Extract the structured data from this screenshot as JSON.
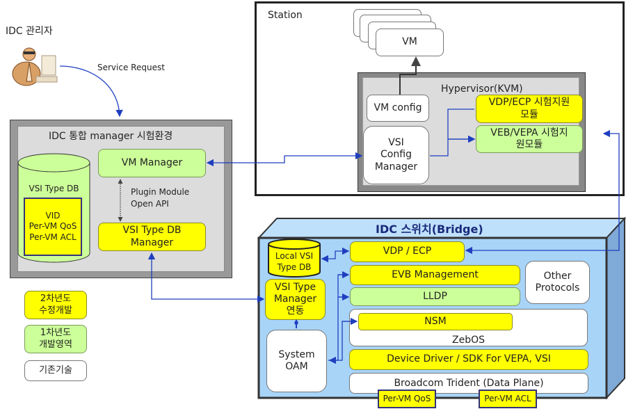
{
  "admin": {
    "label": "IDC 관리자",
    "icon": "person-at-computer-icon"
  },
  "service_request": "Service Request",
  "manager_env": {
    "title": "IDC 통합 manager 시험환경",
    "db": {
      "label": "VSI Type DB",
      "items": [
        "VID",
        "Per-VM  QoS",
        "Per-VM  ACL"
      ]
    },
    "vm_manager": "VM Manager",
    "plugin_label": [
      "Plugin  Module",
      "Open  API"
    ],
    "vsi_db_manager": [
      "VSI Type DB",
      "Manager"
    ]
  },
  "station": {
    "title": "Station",
    "vm": "VM",
    "hypervisor": "Hypervisor(KVM)",
    "vm_config": "VM config",
    "vsi_config_manager": [
      "VSI",
      "Config",
      "Manager"
    ],
    "vdp_ecp_module": [
      "VDP/ECP 시험지원",
      "모듈"
    ],
    "veb_vepa_module": [
      "VEB/VEPA  시험지",
      "원모듈"
    ]
  },
  "bridge": {
    "title": "IDC 스위치(Bridge)",
    "local_db": [
      "Local  VSI",
      "Type  DB"
    ],
    "vsi_type_manager": [
      "VSI Type",
      "Manager",
      "연동"
    ],
    "system_oam": [
      "System",
      "OAM"
    ],
    "vdp_ecp": "VDP / ECP",
    "evb_mgmt": "EVB Management",
    "lldp": "LLDP",
    "other_protocols": [
      "Other",
      "Protocols"
    ],
    "nsm": "NSM",
    "zebos": "ZebOS",
    "device_driver": "Device Driver  /  SDK For VEPA, VSI",
    "broadcom": "Broadcom Trident (Data Plane)",
    "per_vm_qos": "Per-VM  QoS",
    "per_vm_acl": "Per-VM  ACL"
  },
  "legend": [
    {
      "label": [
        "2차년도",
        "수정개발"
      ],
      "color": "#ffff00"
    },
    {
      "label": [
        "1차년도",
        "개발영역"
      ],
      "color": "#ccff99"
    },
    {
      "label": [
        "기존기술"
      ],
      "color": "#ffffff"
    }
  ],
  "colors": {
    "connector": "#1f3fbf",
    "bridge_bg": "#a8d4f8",
    "manager_bg": "#dcdcdc"
  }
}
